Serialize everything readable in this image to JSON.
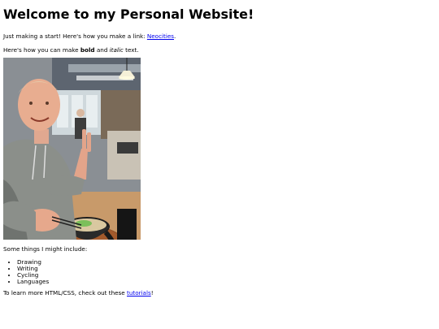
{
  "page": {
    "heading": "Welcome to my Personal Website!",
    "intro": {
      "text_before": "Just making a start! Here's how you make a link: ",
      "link_label": "Neocities",
      "text_after": "."
    },
    "formatting": {
      "text_before": "Here's how you can make ",
      "bold_word": "bold",
      "text_middle": " and ",
      "italic_word": "italic",
      "text_after": " text."
    },
    "photo": {
      "icon": "photo-of-person-with-ramen-bowl"
    },
    "things_intro": "Some things I might include:",
    "things": [
      "Drawing",
      "Writing",
      "Cycling",
      "Languages"
    ],
    "outro": {
      "text_before": "To learn more HTML/CSS, check out these ",
      "link_label": "tutorials",
      "text_after": "!"
    }
  },
  "colors": {
    "link": "#0000ee",
    "text": "#000000",
    "background": "#ffffff"
  }
}
